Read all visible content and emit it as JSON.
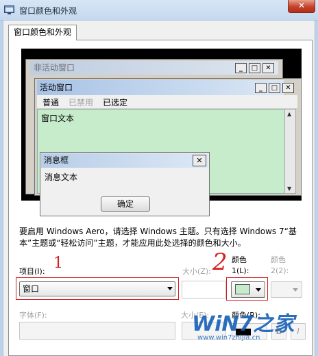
{
  "window": {
    "title": "窗口颜色和外观",
    "close_glyph": "✕"
  },
  "tab": {
    "label": "窗口颜色和外观"
  },
  "preview": {
    "inactive_title": "非活动窗口",
    "active_title": "活动窗口",
    "menu": [
      "普通",
      "已禁用",
      "已选定"
    ],
    "window_text": "窗口文本",
    "msgbox_title": "消息框",
    "msgbox_text": "消息文本",
    "ok_label": "确定"
  },
  "info_text": "要启用 Windows Aero，请选择 Windows 主题。只有选择 Windows 7“基本”主题或“轻松访问”主题，才能应用此处选择的颜色和大小。",
  "fields": {
    "item_label": "项目(I):",
    "item_value": "窗口",
    "size_label": "大小(Z):",
    "color1_label_line1": "颜色",
    "color1_label_line2": "1(L):",
    "color2_label_line1": "颜色",
    "color2_label_line2": "2(2):",
    "font_label": "字体(F):",
    "size2_label": "大小(E):",
    "color3_label": "颜色(R):",
    "bold_label": "B",
    "italic_label": "I"
  },
  "colors": {
    "color1": "#c7eccb",
    "color3": "#000000",
    "annotation": "#d32020"
  },
  "annotations": {
    "num1": "1",
    "num2": "2"
  },
  "watermark": {
    "big": "WiN7之家",
    "url": "www.win7zhijia.cn"
  }
}
